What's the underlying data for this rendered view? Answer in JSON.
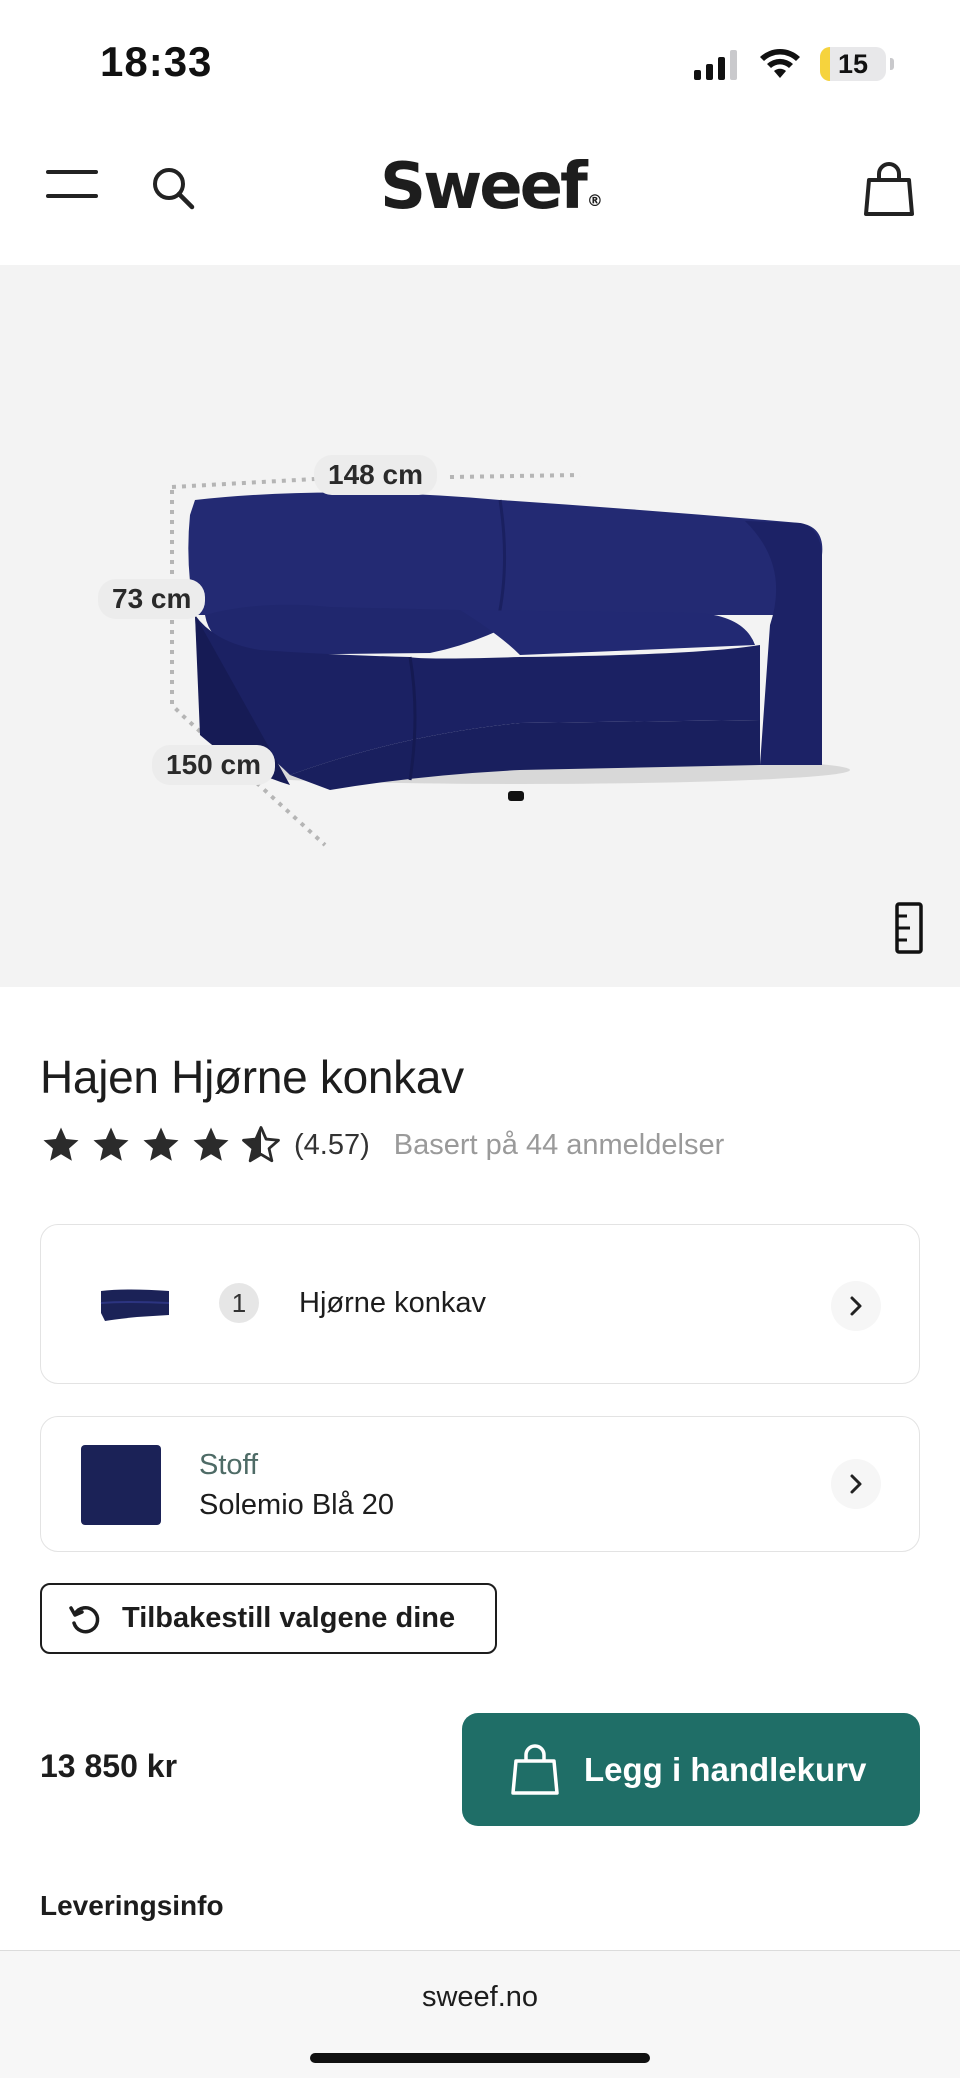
{
  "status_bar": {
    "time": "18:33",
    "battery_level": "15",
    "battery_fraction": 0.15,
    "icons": [
      "signal-icon",
      "wifi-icon",
      "battery-icon"
    ]
  },
  "header": {
    "logo_text": "Sweef",
    "logo_mark": "®",
    "icons": [
      "menu-icon",
      "search-icon",
      "shopping-bag-icon"
    ]
  },
  "product_image": {
    "dimension_width": "148 cm",
    "dimension_height": "73 cm",
    "dimension_depth": "150 cm",
    "sofa_color": "#1b2257",
    "icon": "ruler-icon"
  },
  "product": {
    "title": "Hajen Hjørne konkav",
    "rating_value": "(4.57)",
    "rating_stars": 4.57,
    "rating_count": "Basert på 44 anmeldelser"
  },
  "options": {
    "module": {
      "quantity": "1",
      "name": "Hjørne konkav"
    },
    "fabric": {
      "label": "Stoff",
      "value": "Solemio Blå 20",
      "swatch_color": "#1b2257"
    }
  },
  "reset_label": "Tilbakestill valgene dine",
  "price": "13 850 kr",
  "cta_label": "Legg i handlekurv",
  "delivery_label": "Leveringsinfo",
  "browser": {
    "url": "sweef.no"
  },
  "colors": {
    "accent": "#1f6e67",
    "star": "#2b2b2b",
    "muted_text": "#9a9a9a"
  }
}
